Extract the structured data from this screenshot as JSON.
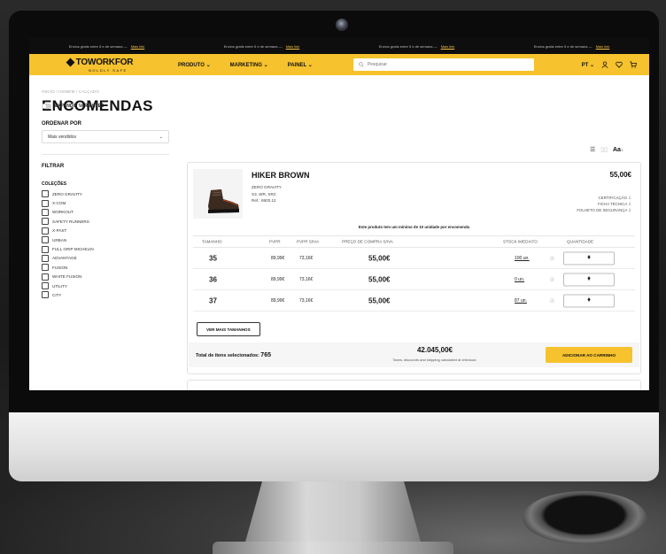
{
  "promo": {
    "items": [
      {
        "text": "Envios gratis entre 5 e de semana",
        "link": "Mais link"
      },
      {
        "text": "Envios gratis entre 5 e de semana",
        "link": "Mais link"
      },
      {
        "text": "Envios gratis entre 5 e de semana",
        "link": "Mais link"
      },
      {
        "text": "Envios gratis entre 5 e de semana",
        "link": "Mais link"
      }
    ]
  },
  "nav": {
    "logo": "TOWORKFOR",
    "logo_sub": "BOLDLY SAFE",
    "menu": [
      "PRODUTO",
      "MARKETING",
      "PAINEL"
    ],
    "search_placeholder": "Pesquisar",
    "lang": "PT",
    "icons": [
      "user-icon",
      "heart-icon",
      "cart-icon"
    ]
  },
  "breadcrumb": "INÍCIO / HOMEM / CALÇADO",
  "page_title": "ENCOMENDAS",
  "sidebar": {
    "expand_label": "EXPANDIR VARIANTES",
    "sort_label": "ORDENAR POR",
    "sort_value": "Mais vendidos",
    "filter_label": "FILTRAR",
    "collections_label": "COLEÇÕES",
    "collections": [
      "ZERO GRAVITY",
      "X-COM",
      "WORKOUT",
      "SAFETY RUNNERS",
      "X-PAST",
      "URBAN",
      "FULL GRIP MICHELIN",
      "ADVANTAGE",
      "FUSION",
      "WHITE FUSION",
      "UTILITY",
      "CITY"
    ]
  },
  "view": {
    "text_size": "Aa"
  },
  "product": {
    "name": "HIKER BROWN",
    "collection": "ZERO GRAVITY",
    "spec": "S3, WR, SRC",
    "ref": "Ref.: 6903.12",
    "price": "55,00€",
    "links": [
      "CERTIFICAÇÃO",
      "FICHA TÉCNICA",
      "FOLHETO DE SEGURANÇA"
    ],
    "note": "Este produto tem um mínimo de 10 unidade por encomenda",
    "headers": [
      "TAMANHO",
      "PVPR",
      "PVPR S/IVA",
      "PREÇO DE COMPRA S/IVA",
      "STOCK IMEDIATO",
      "QUANTIDADE"
    ],
    "rows": [
      {
        "size": "35",
        "pvpr": "89,99€",
        "pvpr_noiva": "73,16€",
        "price": "55,00€",
        "stock": "100 un.",
        "qty": "0"
      },
      {
        "size": "36",
        "pvpr": "89,99€",
        "pvpr_noiva": "73,16€",
        "price": "55,00€",
        "stock": "0 un.",
        "qty": "0"
      },
      {
        "size": "37",
        "pvpr": "89,99€",
        "pvpr_noiva": "73,16€",
        "price": "55,00€",
        "stock": "87 un.",
        "qty": "0"
      }
    ],
    "more_sizes": "VER MAIS TAMANHOS",
    "total_label": "Total de itens selecionados:",
    "total_count": "765",
    "total_amount": "42.045,00€",
    "total_note": "Taxes, discounts and shipping calculated at checkout.",
    "cart_button": "ADICIONAR AO CARRINHO"
  }
}
